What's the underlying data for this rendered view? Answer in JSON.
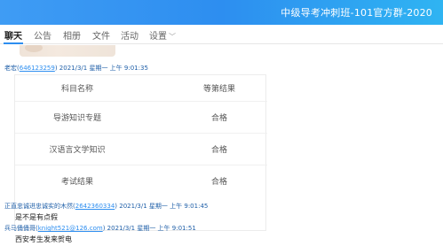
{
  "window": {
    "title": "中级导考冲刺班-101官方群-2020"
  },
  "tabs": [
    {
      "label": "聊天",
      "active": true
    },
    {
      "label": "公告",
      "active": false
    },
    {
      "label": "相册",
      "active": false
    },
    {
      "label": "文件",
      "active": false
    },
    {
      "label": "活动",
      "active": false
    },
    {
      "label": "设置",
      "active": false,
      "has_dropdown": true
    }
  ],
  "messages": [
    {
      "sender_name": "老宏",
      "sender_id": "646123259",
      "timestamp": "2021/3/1 星期一 上午 9:01:35",
      "table": {
        "headers": [
          "科目名称",
          "等第结果"
        ],
        "rows": [
          [
            "导游知识专题",
            "合格"
          ],
          [
            "汉语言文学知识",
            "合格"
          ],
          [
            "考试结果",
            "合格"
          ]
        ]
      }
    },
    {
      "sender_name": "正直忠诚进忠诚实的木然",
      "sender_id": "2642360334",
      "timestamp": "2021/3/1 星期一 上午 9:01:45",
      "text": "是不是有点假"
    },
    {
      "sender_name": "兵马俑俑哥",
      "sender_id": "knight521@126.com",
      "timestamp": "2021/3/1 星期一 上午 9:01:51",
      "text": "西安考生发来贺电"
    }
  ],
  "colors": {
    "titlebar_start": "#3f9cf4",
    "titlebar_end": "#2fb4f2",
    "accent": "#2d8ef0",
    "sender": "#1f5fa8"
  }
}
